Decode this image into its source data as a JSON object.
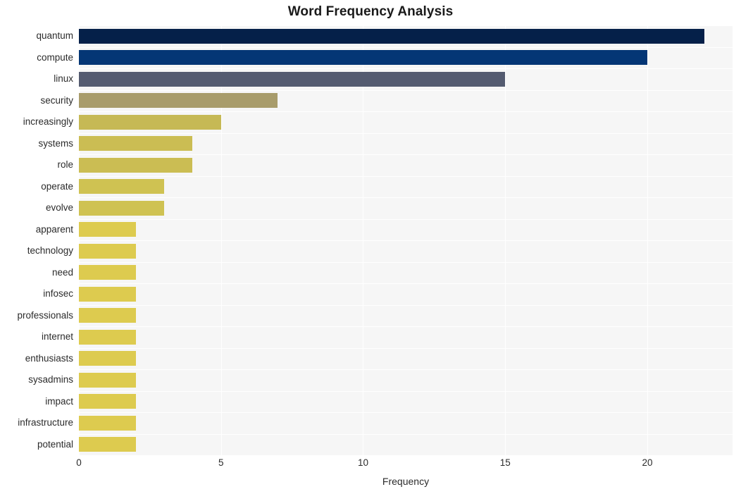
{
  "chart_data": {
    "type": "bar",
    "orientation": "horizontal",
    "title": "Word Frequency Analysis",
    "xlabel": "Frequency",
    "ylabel": "",
    "xlim": [
      0,
      23
    ],
    "xticks": [
      0,
      5,
      10,
      15,
      20
    ],
    "xticklabels": [
      "0",
      "5",
      "10",
      "15",
      "20"
    ],
    "grid": true,
    "grid_color": "#ffffff",
    "plot_background": "#f6f6f6",
    "legend": null,
    "categories": [
      "quantum",
      "compute",
      "linux",
      "security",
      "increasingly",
      "systems",
      "role",
      "operate",
      "evolve",
      "apparent",
      "technology",
      "need",
      "infosec",
      "professionals",
      "internet",
      "enthusiasts",
      "sysadmins",
      "impact",
      "infrastructure",
      "potential"
    ],
    "values": [
      22,
      20,
      15,
      7,
      5,
      4,
      4,
      3,
      3,
      2,
      2,
      2,
      2,
      2,
      2,
      2,
      2,
      2,
      2,
      2
    ],
    "bar_colors": [
      "#052049",
      "#043675",
      "#545b70",
      "#a89c6b",
      "#c6b955",
      "#cbbd53",
      "#cbbd53",
      "#cfc252",
      "#cfc252",
      "#ddcb4f",
      "#ddcb4f",
      "#ddcb4f",
      "#ddcb4f",
      "#ddcb4f",
      "#ddcb4f",
      "#ddcb4f",
      "#ddcb4f",
      "#ddcb4f",
      "#ddcb4f",
      "#ddcb4f"
    ]
  }
}
